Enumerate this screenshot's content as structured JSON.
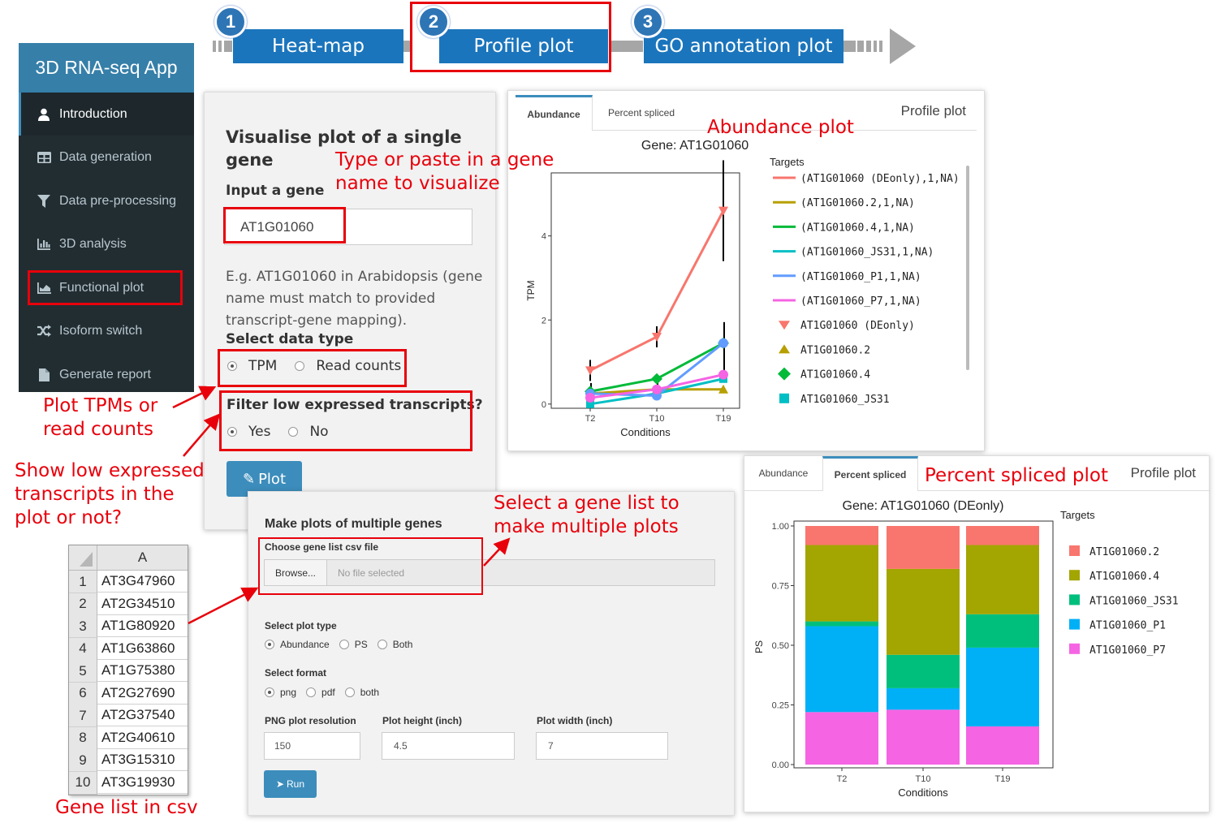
{
  "workflow": {
    "steps": [
      {
        "num": "1",
        "label": "Heat-map"
      },
      {
        "num": "2",
        "label": "Profile plot"
      },
      {
        "num": "3",
        "label": "GO annotation plot"
      }
    ]
  },
  "sidebar": {
    "app_title": "3D RNA-seq App",
    "items": [
      {
        "label": "Introduction",
        "icon": "user-icon"
      },
      {
        "label": "Data generation",
        "icon": "table-icon"
      },
      {
        "label": "Data pre-processing",
        "icon": "filter-icon"
      },
      {
        "label": "3D analysis",
        "icon": "bar-chart-icon"
      },
      {
        "label": "Functional plot",
        "icon": "area-chart-icon"
      },
      {
        "label": "Isoform switch",
        "icon": "shuffle-icon"
      },
      {
        "label": "Generate report",
        "icon": "file-icon"
      }
    ]
  },
  "single_gene": {
    "title_line1": "Visualise plot of a single",
    "title_line2": "gene",
    "input_label": "Input a gene",
    "input_value": "AT1G01060",
    "help_line1": "E.g. AT1G01060 in Arabidopsis (gene",
    "help_line2": "name must match to provided",
    "help_line3": "transcript-gene mapping).",
    "data_type_label": "Select data type",
    "data_type_options": [
      "TPM",
      "Read counts"
    ],
    "filter_label": "Filter low expressed transcripts?",
    "filter_options": [
      "Yes",
      "No"
    ],
    "plot_button": "Plot"
  },
  "multi_gene": {
    "title": "Make plots of multiple genes",
    "file_label": "Choose gene list csv file",
    "browse_button": "Browse...",
    "file_placeholder": "No file selected",
    "plot_type_label": "Select plot type",
    "plot_type_options": [
      "Abundance",
      "PS",
      "Both"
    ],
    "format_label": "Select format",
    "format_options": [
      "png",
      "pdf",
      "both"
    ],
    "res_label": "PNG plot resolution",
    "res_value": "150",
    "height_label": "Plot height (inch)",
    "height_value": "4.5",
    "width_label": "Plot width (inch)",
    "width_value": "7",
    "run_button": "Run"
  },
  "abundance_panel": {
    "tabs": [
      "Abundance",
      "Percent spliced"
    ],
    "header": "Profile plot",
    "chart_title": "Gene: AT1G01060",
    "legend_title": "Targets",
    "legend_items": [
      "(AT1G01060 (DEonly),1,NA)",
      "(AT1G01060.2,1,NA)",
      "(AT1G01060.4,1,NA)",
      "(AT1G01060_JS31,1,NA)",
      "(AT1G01060_P1,1,NA)",
      "(AT1G01060_P7,1,NA)",
      "AT1G01060 (DEonly)",
      "AT1G01060.2",
      "AT1G01060.4",
      "AT1G01060_JS31"
    ],
    "y_ticks": [
      "0",
      "2",
      "4"
    ],
    "colors": {
      "deonly": "#f8766d",
      "v2": "#b79f00",
      "v4": "#00ba38",
      "js31": "#00bfc4",
      "p1": "#619cff",
      "p7": "#f564e3"
    }
  },
  "ps_panel": {
    "tabs": [
      "Abundance",
      "Percent spliced"
    ],
    "header": "Profile plot",
    "chart_title": "Gene: AT1G01060 (DEonly)",
    "legend_title": "Targets",
    "legend_items": [
      "AT1G01060.2",
      "AT1G01060.4",
      "AT1G01060_JS31",
      "AT1G01060_P1",
      "AT1G01060_P7"
    ],
    "y_ticks": [
      "0.00",
      "0.25",
      "0.50",
      "0.75",
      "1.00"
    ]
  },
  "chart_data": [
    {
      "type": "line",
      "title": "Gene: AT1G01060",
      "xlabel": "Conditions",
      "ylabel": "TPM",
      "categories": [
        "T2",
        "T10",
        "T19"
      ],
      "ylim": [
        -0.1,
        5.5
      ],
      "legend_title": "Targets",
      "legend_position": "right",
      "error_bars": true,
      "series": [
        {
          "name": "AT1G01060 (DEonly)",
          "values": [
            0.8,
            1.6,
            4.6
          ],
          "color": "#f8766d",
          "marker": "triangle-down"
        },
        {
          "name": "AT1G01060.2",
          "values": [
            0.25,
            0.35,
            0.35
          ],
          "color": "#b79f00",
          "marker": "triangle-up"
        },
        {
          "name": "AT1G01060.4",
          "values": [
            0.3,
            0.6,
            1.45
          ],
          "color": "#00ba38",
          "marker": "diamond"
        },
        {
          "name": "AT1G01060_JS31",
          "values": [
            0.0,
            0.25,
            0.6
          ],
          "color": "#00bfc4",
          "marker": "square"
        },
        {
          "name": "AT1G01060_P1",
          "values": [
            0.25,
            0.2,
            1.45
          ],
          "color": "#619cff",
          "marker": "circle"
        },
        {
          "name": "AT1G01060_P7",
          "values": [
            0.15,
            0.35,
            0.7
          ],
          "color": "#f564e3",
          "marker": "circle"
        }
      ]
    },
    {
      "type": "bar",
      "stacked": true,
      "title": "Gene: AT1G01060 (DEonly)",
      "xlabel": "Conditions",
      "ylabel": "PS",
      "categories": [
        "T2",
        "T10",
        "T19"
      ],
      "ylim": [
        0,
        1
      ],
      "legend_title": "Targets",
      "legend_position": "right",
      "series": [
        {
          "name": "AT1G01060_P7",
          "values": [
            0.22,
            0.23,
            0.16
          ],
          "color": "#f564e3"
        },
        {
          "name": "AT1G01060_P1",
          "values": [
            0.36,
            0.09,
            0.33
          ],
          "color": "#00b0f6"
        },
        {
          "name": "AT1G01060_JS31",
          "values": [
            0.02,
            0.14,
            0.14
          ],
          "color": "#00bf7d"
        },
        {
          "name": "AT1G01060.4",
          "values": [
            0.32,
            0.36,
            0.29
          ],
          "color": "#a3a500"
        },
        {
          "name": "AT1G01060.2",
          "values": [
            0.08,
            0.18,
            0.08
          ],
          "color": "#f8766d"
        }
      ]
    }
  ],
  "csv": {
    "column": "A",
    "rows": [
      {
        "n": "1",
        "gene": "AT3G47960"
      },
      {
        "n": "2",
        "gene": "AT2G34510"
      },
      {
        "n": "3",
        "gene": "AT1G80920"
      },
      {
        "n": "4",
        "gene": "AT1G63860"
      },
      {
        "n": "5",
        "gene": "AT1G75380"
      },
      {
        "n": "6",
        "gene": "AT2G27690"
      },
      {
        "n": "7",
        "gene": "AT2G37540"
      },
      {
        "n": "8",
        "gene": "AT2G40610"
      },
      {
        "n": "9",
        "gene": "AT3G15310"
      },
      {
        "n": "10",
        "gene": "AT3G19930"
      }
    ]
  },
  "callouts": {
    "type_gene_1": "Type or paste in a gene",
    "type_gene_2": "name to visualize",
    "plot_tpm_1": "Plot TPMs or",
    "plot_tpm_2": "read counts",
    "show_low_1": "Show low expressed",
    "show_low_2": "transcripts in the",
    "show_low_3": "plot or not?",
    "select_list_1": "Select a gene list to",
    "select_list_2": "make multiple plots",
    "gene_list": "Gene list in csv",
    "abundance_plot": "Abundance plot",
    "ps_plot": "Percent spliced plot"
  }
}
